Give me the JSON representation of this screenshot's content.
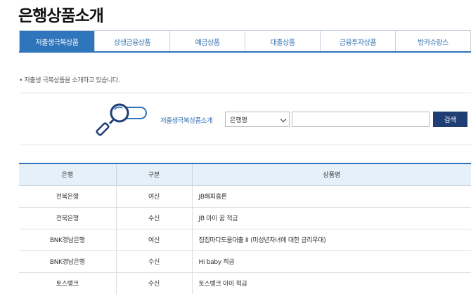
{
  "page": {
    "title": "은행상품소개"
  },
  "tabs": [
    {
      "label": "저출생극복상품",
      "active": true
    },
    {
      "label": "상생금융상품",
      "active": false
    },
    {
      "label": "예금상품",
      "active": false
    },
    {
      "label": "대출상품",
      "active": false
    },
    {
      "label": "금융투자상품",
      "active": false
    },
    {
      "label": "방카슈랑스",
      "active": false
    }
  ],
  "intro": "• 저출생 극복상품을 소개하고 있습니다.",
  "search": {
    "label": "저출생극복상품소개",
    "select_value": "은행명",
    "input_value": "",
    "button_label": "검색"
  },
  "table": {
    "headers": [
      "은행",
      "구분",
      "상품명"
    ],
    "rows": [
      [
        "전북은행",
        "여신",
        "JB해피홈론"
      ],
      [
        "전북은행",
        "수신",
        "JB 아이 꿈 적금"
      ],
      [
        "BNK경남은행",
        "여신",
        "집집마다도움대출 II  (미성년자녀에 대한 금리우대)"
      ],
      [
        "BNK경남은행",
        "수신",
        "Hi baby 적금"
      ],
      [
        "토스뱅크",
        "수신",
        "토스뱅크 아이 적금"
      ]
    ]
  },
  "colors": {
    "accent": "#2f75bb",
    "button": "#1f3f74",
    "header_bg": "#e6f0f9"
  },
  "icons": {
    "search_illustration": "magnifier-icon",
    "select": "chevron-down-icon"
  }
}
